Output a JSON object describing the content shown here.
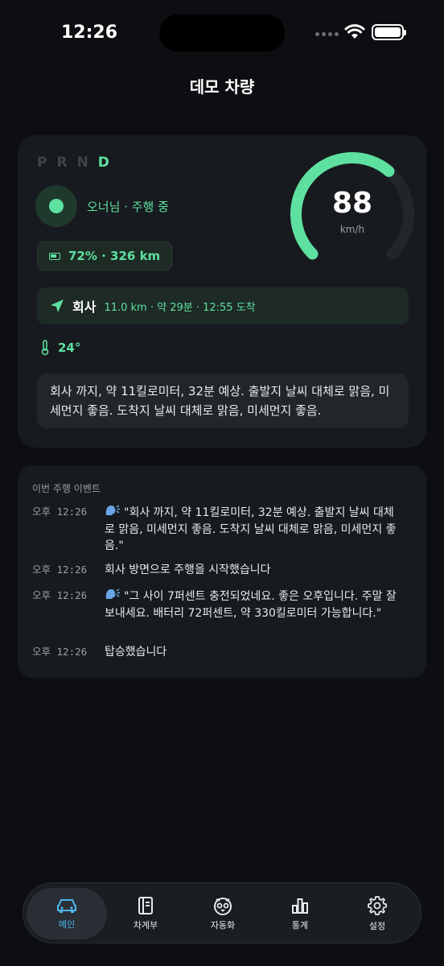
{
  "status_bar": {
    "time": "12:26"
  },
  "header": {
    "title": "데모 차량"
  },
  "vehicle": {
    "gears": [
      "P",
      "R",
      "N",
      "D"
    ],
    "active_gear": "D",
    "owner_status": "오너님 · 주행 중",
    "range": "72% · 326 km",
    "speed": "88",
    "speed_unit": "km/h",
    "speed_fraction": 0.65,
    "navigation": {
      "destination": "회사",
      "info": "11.0 km · 약 29분 · 12:55 도착"
    },
    "temperature": "24°",
    "summary": "회사 까지, 약 11킬로미터, 32분 예상. 출발지 날씨 대체로 맑음, 미세먼지 좋음. 도착지 날씨 대체로 맑음, 미세먼지 좋음."
  },
  "events": {
    "title": "이번 주행 이벤트",
    "items": [
      {
        "time": "오후 12:26",
        "speak": true,
        "message": "\"회사 까지, 약 11킬로미터, 32분 예상. 출발지 날씨 대체로 맑음, 미세먼지 좋음. 도착지 날씨 대체로 맑음, 미세먼지 좋음.\""
      },
      {
        "time": "오후 12:26",
        "speak": false,
        "message": "회사 방면으로 주행을 시작했습니다"
      },
      {
        "time": "오후 12:26",
        "speak": true,
        "message": "\"그 사이 7퍼센트 충전되었네요. 좋은 오후입니다. 주말 잘 보내세요. 배터리 72퍼센트, 약 330킬로미터 가능합니다.\""
      },
      {
        "time": "오후 12:26",
        "speak": false,
        "message": "탑승했습니다"
      }
    ]
  },
  "tabs": [
    {
      "label": "메인",
      "icon": "car-icon",
      "active": true
    },
    {
      "label": "차계부",
      "icon": "logbook-icon",
      "active": false
    },
    {
      "label": "자동화",
      "icon": "automation-icon",
      "active": false
    },
    {
      "label": "통계",
      "icon": "stats-icon",
      "active": false
    },
    {
      "label": "설정",
      "icon": "gear-icon",
      "active": false
    }
  ],
  "colors": {
    "accent_green": "#5ee0a0",
    "accent_blue": "#4db8f0",
    "background": "#0c0e11",
    "card": "#171a1e"
  }
}
